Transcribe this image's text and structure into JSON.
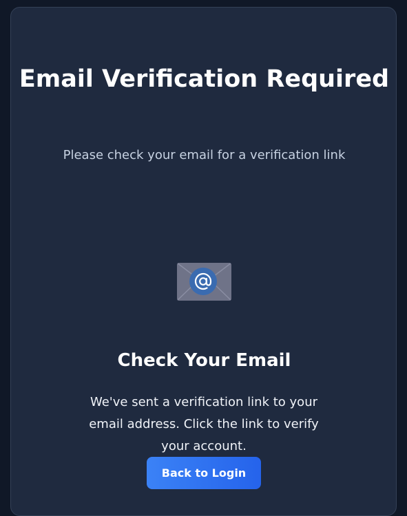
{
  "page": {
    "title": "Email Verification Required",
    "subtitle": "Please check your email for a verification link"
  },
  "icon": {
    "name": "email-envelope-icon"
  },
  "content": {
    "heading": "Check Your Email",
    "message": "We've sent a verification link to your email address. Click the link to verify your account."
  },
  "actions": {
    "back_to_login_label": "Back to Login"
  },
  "colors": {
    "background": "#101827",
    "card": "#1f2a3f",
    "button": "#2563eb"
  }
}
